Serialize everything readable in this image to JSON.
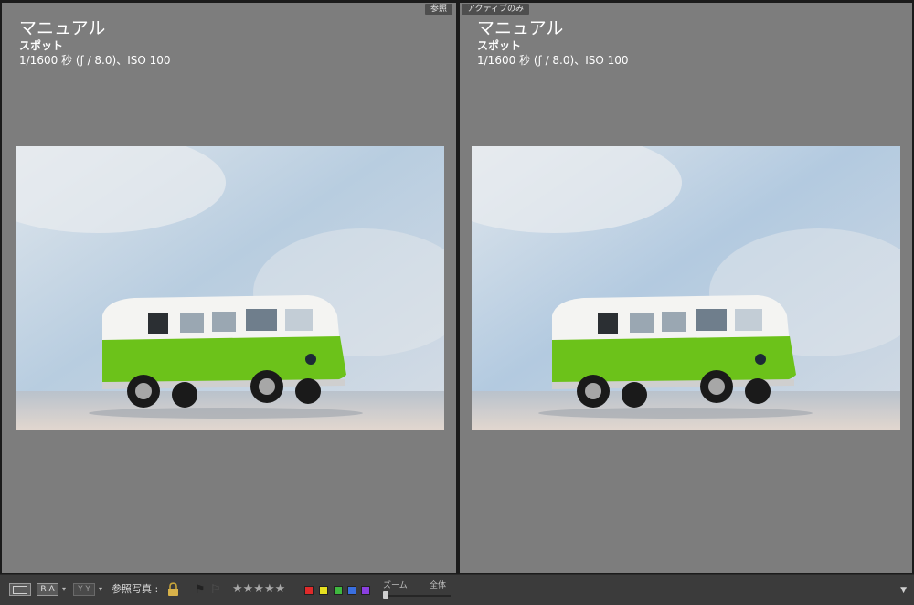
{
  "left_pane": {
    "tag": "参照",
    "exposure_mode": "マニュアル",
    "metering": "スポット",
    "exposure_info": "1/1600 秒 (ƒ / 8.0)、ISO 100"
  },
  "right_pane": {
    "tag": "アクティブのみ",
    "exposure_mode": "マニュアル",
    "metering": "スポット",
    "exposure_info": "1/1600 秒 (ƒ / 8.0)、ISO 100"
  },
  "toolbar": {
    "view_loupe_icon": "loupe-view-icon",
    "view_ra_label": "R A",
    "view_yy_label": "Y Y",
    "reference_label": "参照写真 :",
    "lock_icon": "lock-icon",
    "stars": "★★★★★",
    "color_labels": [
      "#e02a2a",
      "#e6e020",
      "#3fb83f",
      "#3a6fe0",
      "#8a3fe0"
    ],
    "zoom_label": "ズーム",
    "zoom_fit_label": "全体",
    "zoom_level": 0
  }
}
